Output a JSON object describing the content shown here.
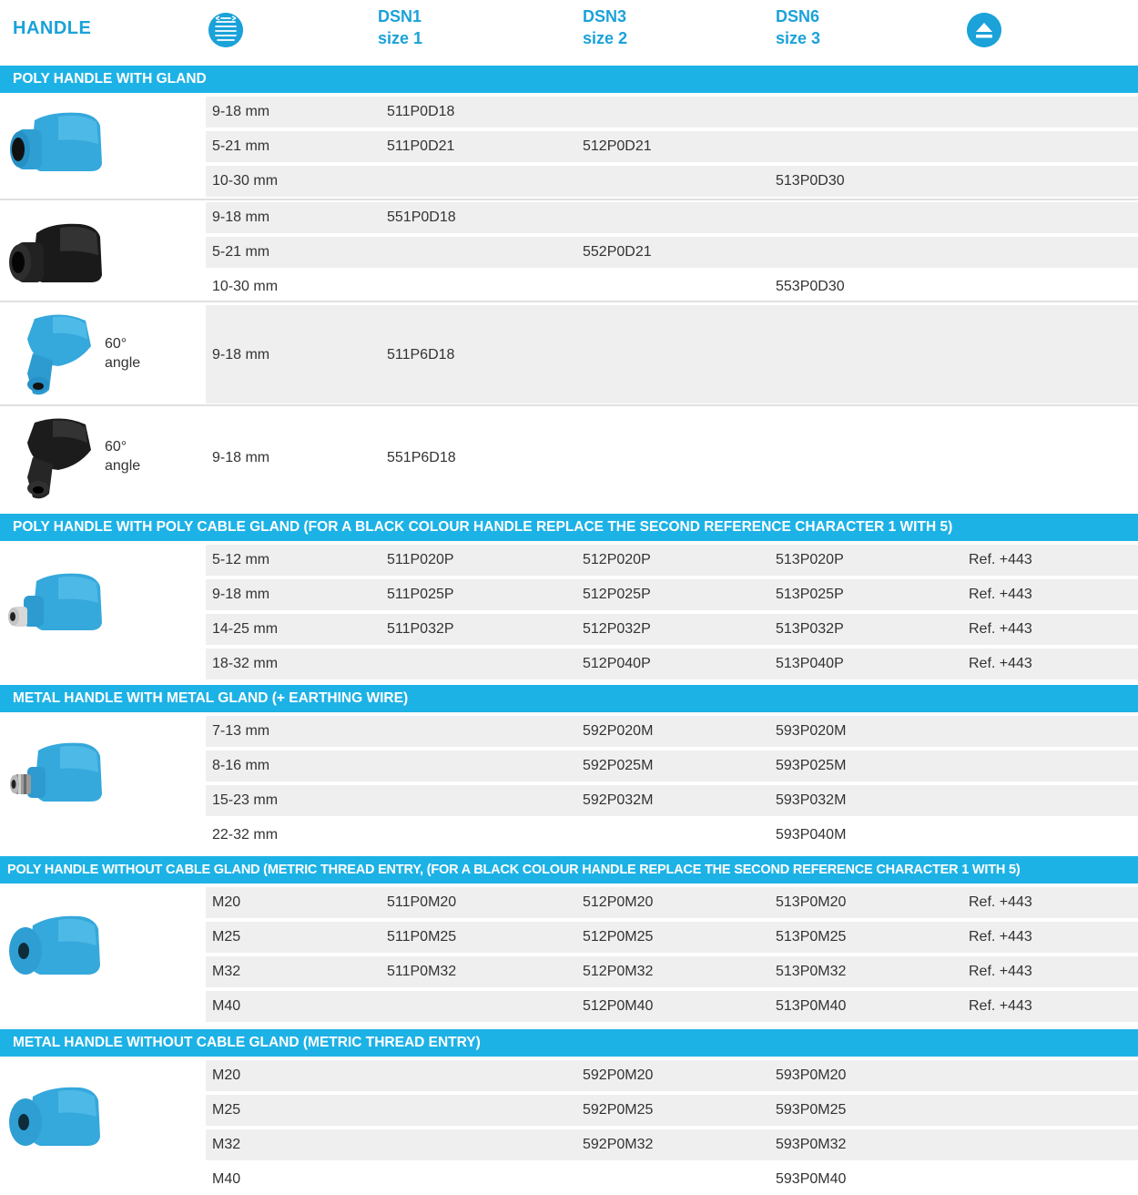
{
  "header": {
    "handle": "HANDLE",
    "dsn1": "DSN1",
    "dsn1_size": "size 1",
    "dsn3": "DSN3",
    "dsn3_size": "size 2",
    "dsn6": "DSN6",
    "dsn6_size": "size 3",
    "cable_icon": "cable-diameter-icon",
    "eject_icon": "eject-icon"
  },
  "sections": {
    "s1": {
      "title": "POLY HANDLE WITH GLAND",
      "blue_rows": [
        [
          "9-18 mm",
          "511P0D18",
          "",
          "",
          ""
        ],
        [
          "5-21 mm",
          "511P0D21",
          "512P0D21",
          "",
          ""
        ],
        [
          "10-30 mm",
          "",
          "",
          "513P0D30",
          ""
        ]
      ],
      "black_rows": [
        [
          "9-18 mm",
          "551P0D18",
          "",
          "",
          ""
        ],
        [
          "5-21 mm",
          "",
          "552P0D21",
          "",
          ""
        ],
        [
          "10-30 mm",
          "",
          "",
          "553P0D30",
          ""
        ]
      ],
      "angle_blue": {
        "label1": "60°",
        "label2": "angle",
        "range": "9-18 mm",
        "ref": "511P6D18"
      },
      "angle_black": {
        "label1": "60°",
        "label2": "angle",
        "range": "9-18 mm",
        "ref": "551P6D18"
      }
    },
    "s2": {
      "title": "POLY HANDLE WITH POLY CABLE GLAND (FOR A BLACK COLOUR HANDLE REPLACE THE SECOND REFERENCE CHARACTER 1 WITH 5)",
      "rows": [
        [
          "5-12 mm",
          "511P020P",
          "512P020P",
          "513P020P",
          "Ref. +443"
        ],
        [
          "9-18 mm",
          "511P025P",
          "512P025P",
          "513P025P",
          "Ref. +443"
        ],
        [
          "14-25 mm",
          "511P032P",
          "512P032P",
          "513P032P",
          "Ref. +443"
        ],
        [
          "18-32 mm",
          "",
          "512P040P",
          "513P040P",
          "Ref. +443"
        ]
      ]
    },
    "s3": {
      "title": "METAL HANDLE WITH METAL GLAND (+ EARTHING WIRE)",
      "rows": [
        [
          "7-13 mm",
          "",
          "592P020M",
          "593P020M",
          ""
        ],
        [
          "8-16 mm",
          "",
          "592P025M",
          "593P025M",
          ""
        ],
        [
          "15-23 mm",
          "",
          "592P032M",
          "593P032M",
          ""
        ],
        [
          "22-32 mm",
          "",
          "",
          "593P040M",
          ""
        ]
      ]
    },
    "s4": {
      "title": "POLY HANDLE WITHOUT CABLE GLAND (METRIC THREAD ENTRY, (FOR A BLACK COLOUR HANDLE REPLACE THE SECOND REFERENCE CHARACTER 1 WITH 5)",
      "rows": [
        [
          "M20",
          "511P0M20",
          "512P0M20",
          "513P0M20",
          "Ref. +443"
        ],
        [
          "M25",
          "511P0M25",
          "512P0M25",
          "513P0M25",
          "Ref. +443"
        ],
        [
          "M32",
          "511P0M32",
          "512P0M32",
          "513P0M32",
          "Ref. +443"
        ],
        [
          "M40",
          "",
          "512P0M40",
          "513P0M40",
          "Ref. +443"
        ]
      ]
    },
    "s5": {
      "title": "METAL HANDLE WITHOUT CABLE GLAND (METRIC THREAD ENTRY)",
      "rows": [
        [
          "M20",
          "",
          "592P0M20",
          "593P0M20",
          ""
        ],
        [
          "M25",
          "",
          "592P0M25",
          "593P0M25",
          ""
        ],
        [
          "M32",
          "",
          "592P0M32",
          "593P0M32",
          ""
        ],
        [
          "M40",
          "",
          "",
          "593P0M40",
          ""
        ]
      ]
    }
  },
  "colors": {
    "accent": "#1db2e6",
    "header_text": "#1aa2d9",
    "row_grey": "#efefef",
    "handle_blue": "#35a8dc",
    "handle_black": "#1a1a1a"
  }
}
